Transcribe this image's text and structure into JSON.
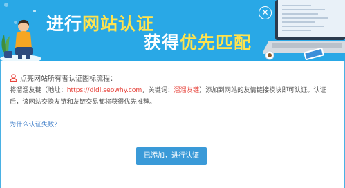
{
  "banner": {
    "title_prefix": "进行",
    "title_highlight": "网站认证",
    "subtitle_prefix": "获得",
    "subtitle_highlight": "优先匹配",
    "close_icon": "close-icon",
    "close_glyph": "✕",
    "colors": {
      "background": "#29a8e6",
      "highlight": "#ffe34d"
    }
  },
  "content": {
    "heading_icon": "user-icon",
    "heading": "点亮网站所有者认证图标流程：",
    "desc_part1": "将溜溜友链（地址：",
    "desc_url": "https://dldl.seowhy.com",
    "desc_part2": "，关键词：",
    "desc_keyword": "溜溜友链",
    "desc_part3": "）添加到网站的友情链接模块即可认证。认证后，该网站交换友链和友链交易都将获得优先推荐。",
    "help_link": "为什么认证失败？",
    "confirm_button": "已添加，进行认证",
    "colors": {
      "accent": "#3a9ad8",
      "emphasis": "#e7433b",
      "link": "#3a7bc8"
    }
  }
}
